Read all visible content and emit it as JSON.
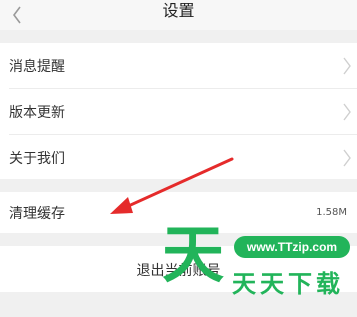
{
  "header": {
    "title": "设置"
  },
  "settings_group": {
    "items": [
      {
        "label": "消息提醒"
      },
      {
        "label": "版本更新"
      },
      {
        "label": "关于我们"
      }
    ]
  },
  "cache": {
    "label": "清理缓存",
    "size": "1.58M"
  },
  "logout": {
    "label": "退出当前账号"
  },
  "watermark": {
    "big_char": "天",
    "url": "www.TTzip.com",
    "text": "天天下载"
  },
  "colors": {
    "watermark_green": "#22b45a",
    "annotation_red": "#e52b2b"
  }
}
